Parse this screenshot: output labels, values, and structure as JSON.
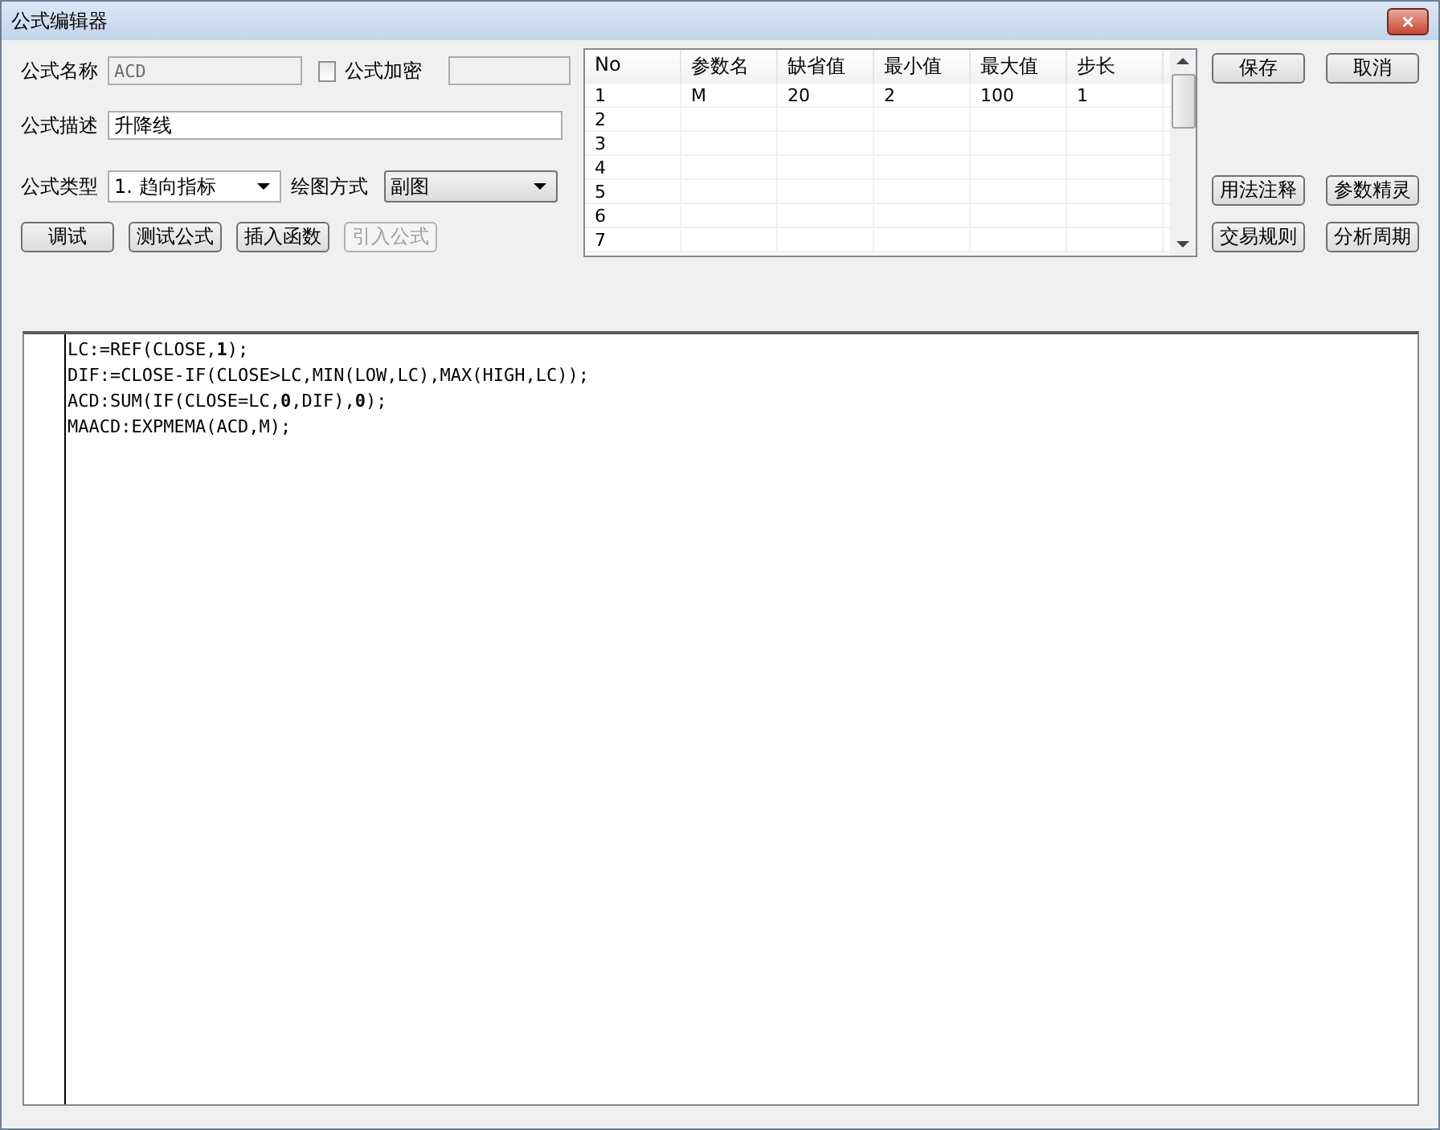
{
  "window": {
    "title": "公式编辑器",
    "close": "×"
  },
  "form": {
    "name_label": "公式名称",
    "name_value": "ACD",
    "encrypt": {
      "label": "公式加密",
      "checked": false
    },
    "desc_label": "公式描述",
    "desc_value": "升降线",
    "type_label": "公式类型",
    "type_value": "1. 趋向指标",
    "draw_label": "绘图方式",
    "draw_value": "副图"
  },
  "left_buttons": [
    {
      "label": "调试",
      "disabled": false
    },
    {
      "label": "测试公式",
      "disabled": false
    },
    {
      "label": "插入函数",
      "disabled": false
    },
    {
      "label": "引入公式",
      "disabled": true
    }
  ],
  "params": {
    "columns": [
      "No",
      "参数名",
      "缺省值",
      "最小值",
      "最大值",
      "步长"
    ],
    "rows": [
      [
        "1",
        "M",
        "20",
        "2",
        "100",
        "1"
      ],
      [
        "2",
        "",
        "",
        "",
        "",
        ""
      ],
      [
        "3",
        "",
        "",
        "",
        "",
        ""
      ],
      [
        "4",
        "",
        "",
        "",
        "",
        ""
      ],
      [
        "5",
        "",
        "",
        "",
        "",
        ""
      ],
      [
        "6",
        "",
        "",
        "",
        "",
        ""
      ],
      [
        "7",
        "",
        "",
        "",
        "",
        ""
      ]
    ]
  },
  "right_buttons": [
    [
      "保存",
      "取消"
    ],
    [
      "用法注释",
      "参数精灵"
    ],
    [
      "交易规则",
      "分析周期"
    ]
  ],
  "code_lines": [
    "LC:=REF(CLOSE,**1**);",
    "DIF:=CLOSE-IF(CLOSE>LC,MIN(LOW,LC),MAX(HIGH,LC));",
    "ACD:SUM(IF(CLOSE=LC,**0**,DIF),**0**);",
    "MAACD:EXPMEMA(ACD,M);"
  ]
}
